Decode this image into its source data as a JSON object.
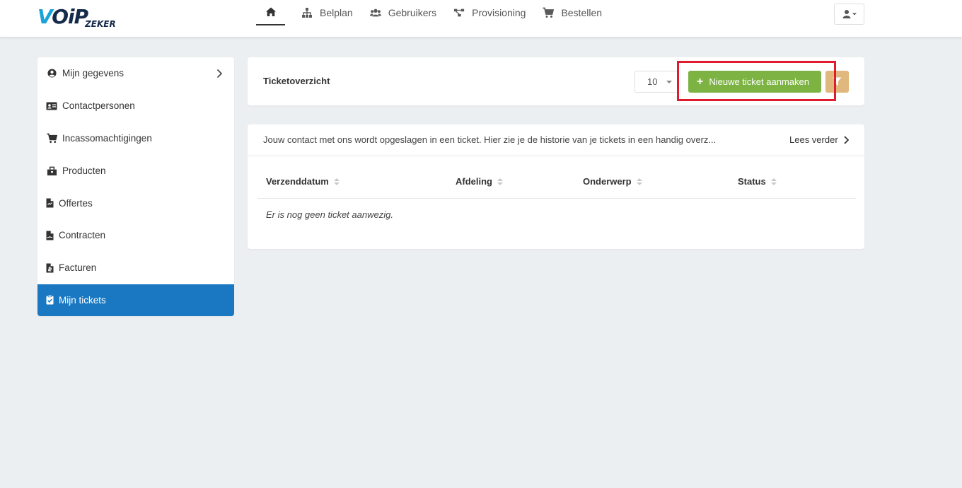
{
  "brand": {
    "logo_main_a": "V",
    "logo_main_b": "OiP",
    "logo_sub": "ZEKER"
  },
  "nav": {
    "items": [
      {
        "label": "Belplan",
        "icon": "sitemap-icon"
      },
      {
        "label": "Gebruikers",
        "icon": "users-icon"
      },
      {
        "label": "Provisioning",
        "icon": "project-diagram-icon"
      },
      {
        "label": "Bestellen",
        "icon": "cart-icon"
      }
    ],
    "home_icon": "home-icon",
    "user_menu_icon": "user-caret-icon"
  },
  "sidebar": {
    "items": [
      {
        "label": "Mijn gegevens",
        "icon": "user-circle-icon"
      },
      {
        "label": "Contactpersonen",
        "icon": "id-card-icon"
      },
      {
        "label": "Incassomachtigingen",
        "icon": "cart-icon"
      },
      {
        "label": "Producten",
        "icon": "box-icon"
      },
      {
        "label": "Offertes",
        "icon": "file-icon"
      },
      {
        "label": "Contracten",
        "icon": "file-signature-icon"
      },
      {
        "label": "Facturen",
        "icon": "file-invoice-icon"
      },
      {
        "label": "Mijn tickets",
        "icon": "clipboard-check-icon",
        "active": true
      }
    ]
  },
  "header": {
    "title": "Ticketoverzicht",
    "page_size": "10",
    "new_button": "Nieuwe ticket aanmaken",
    "filter_icon": "filter-icon"
  },
  "tickets": {
    "info": "Jouw contact met ons wordt opgeslagen in een ticket. Hier zie je de historie van je tickets in een handig overz...",
    "read_more": "Lees verder",
    "columns": [
      "Verzenddatum",
      "Afdeling",
      "Onderwerp",
      "Status"
    ],
    "empty": "Er is nog geen ticket aanwezig."
  },
  "colors": {
    "accent_blue": "#1a78c2",
    "button_green": "#7cb342",
    "filter_tan": "#e0b77c",
    "highlight_red": "#e01b2e"
  }
}
